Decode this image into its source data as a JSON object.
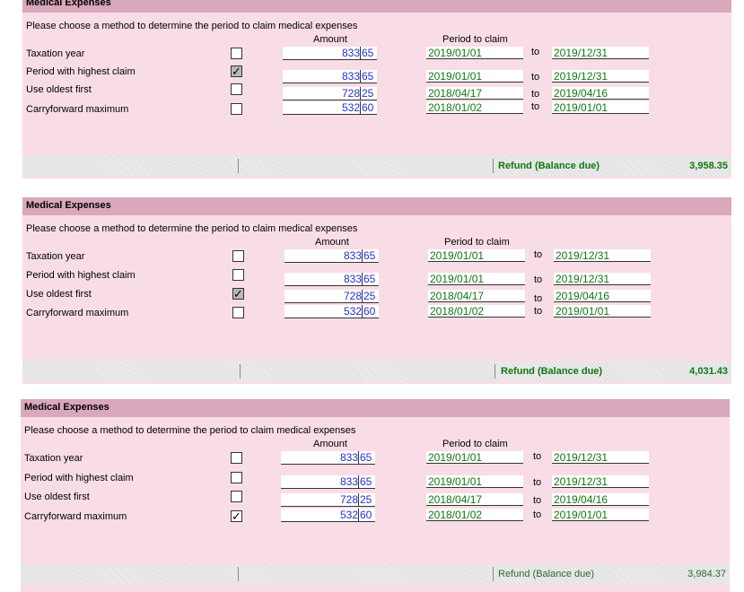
{
  "section_title": "Medical Expenses",
  "prompt": "Please choose a method to determine the period to claim medical expenses",
  "column_headers": {
    "amount": "Amount",
    "period": "Period to claim"
  },
  "to_label": "to",
  "refund_label": "Refund (Balance due)",
  "rows": [
    {
      "label": "Taxation year",
      "dollars": "833",
      "cents": "65",
      "from": "2019/01/01",
      "to": "2019/12/31"
    },
    {
      "label": "Period with highest claim",
      "dollars": "833",
      "cents": "65",
      "from": "2019/01/01",
      "to": "2019/12/31"
    },
    {
      "label": "Use oldest first",
      "dollars": "728",
      "cents": "25",
      "from": "2018/04/17",
      "to": "2019/04/16"
    },
    {
      "label": "Carryforward maximum",
      "dollars": "532",
      "cents": "60",
      "from": "2018/01/02",
      "to": "2019/01/01"
    }
  ],
  "panels": [
    {
      "selected": "Period with highest claim",
      "refund": "3,958.35"
    },
    {
      "selected": "Use oldest first",
      "refund": "4,031.43"
    },
    {
      "selected": "Carryforward maximum",
      "refund": "3,984.37"
    }
  ],
  "colors": {
    "header": "#d9a8bc",
    "panel": "#f8dde6",
    "amount_text": "#2233cc",
    "date_text": "#117711"
  }
}
